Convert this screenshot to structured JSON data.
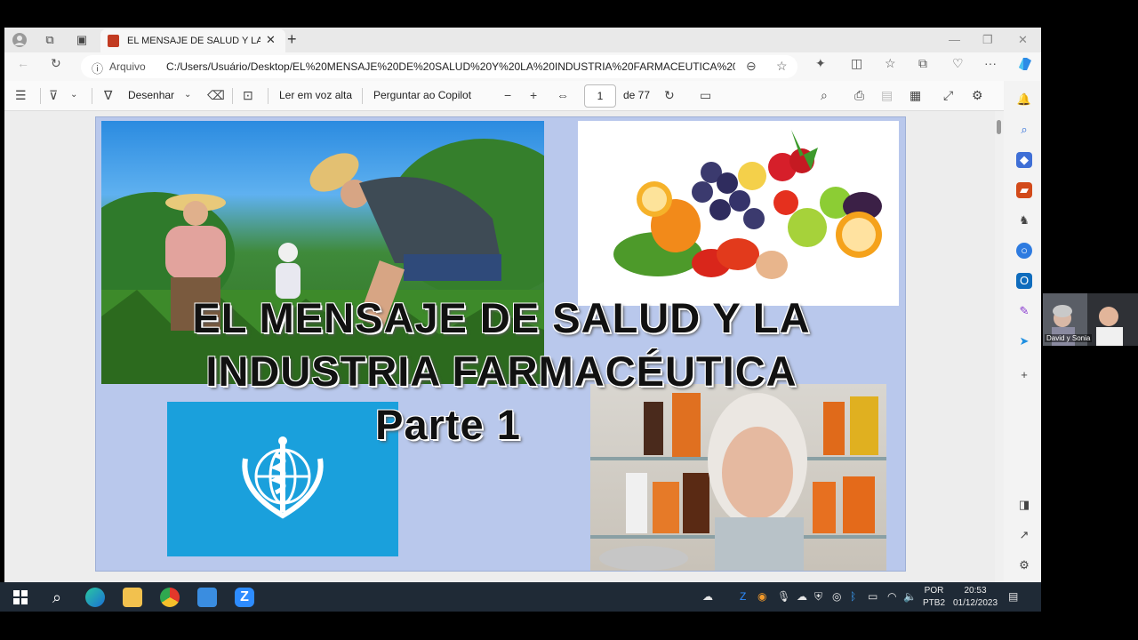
{
  "browser": {
    "tab_title": "EL MENSAJE DE SALUD Y LA INDUSTRIA FARMACEUTICA",
    "address": {
      "prefix": "Arquivo",
      "url": "C:/Users/Usuário/Desktop/EL%20MENSAJE%20DE%20SALUD%20Y%20LA%20INDUSTRIA%20FARMACEUTICA%20-%20..."
    }
  },
  "pdf_toolbar": {
    "draw_label": "Desenhar",
    "read_aloud_label": "Ler em voz alta",
    "copilot_label": "Perguntar ao Copilot",
    "page_current": "1",
    "page_total_label": "de 77"
  },
  "slide": {
    "title_line1": "EL MENSAJE DE SALUD Y LA",
    "title_line2": "INDUSTRIA FARMACÉUTICA",
    "subtitle": "Parte 1"
  },
  "taskbar": {
    "language_line1": "POR",
    "language_line2": "PTB2",
    "time": "20:53",
    "date": "01/12/2023"
  },
  "webcam": {
    "label": "David y Sonia"
  },
  "colors": {
    "slide_bg": "#b9c8ec",
    "who_blue": "#1aa0dc",
    "taskbar": "#1f2a36"
  }
}
